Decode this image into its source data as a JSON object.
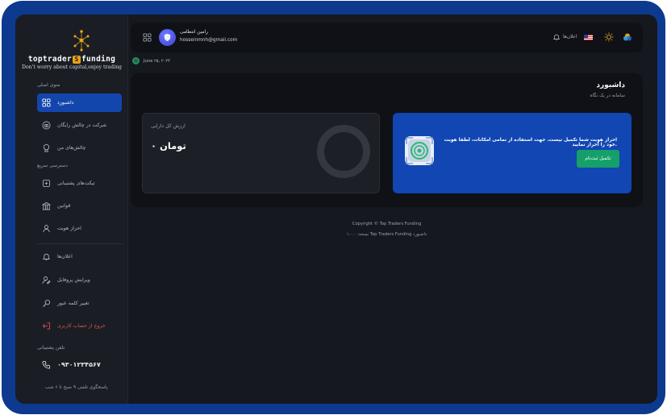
{
  "brand": {
    "name_left": "toptrader",
    "badge": "S",
    "name_right": "funding",
    "tagline": "Don't worry about capital,enjoy trading"
  },
  "sidebar": {
    "main_menu_title": "منوی اصلی",
    "quick_access_title": "دسترسی سریع",
    "items": [
      {
        "label": "داشبورد",
        "icon": "dashboard-grid-icon",
        "active": true
      },
      {
        "label": "شرکت در چالش رایگان",
        "icon": "gift-icon"
      },
      {
        "label": "چالش‌های من",
        "icon": "trophy-icon"
      },
      {
        "label": "تیکت‌های پشتیبانی",
        "icon": "ticket-icon"
      },
      {
        "label": "قوانین",
        "icon": "rules-icon"
      },
      {
        "label": "احراز هویت",
        "icon": "identity-icon"
      },
      {
        "label": "اعلان‌ها",
        "icon": "bell-icon"
      },
      {
        "label": "ویرایش پروفایل",
        "icon": "user-edit-icon"
      },
      {
        "label": "تغییر کلمه عبور",
        "icon": "key-icon"
      },
      {
        "label": "خروج از حساب کاربری",
        "icon": "logout-icon",
        "danger": true
      }
    ],
    "support_title": "تلفن پشتیبانی",
    "support_phone": "۰۹۳۰۱۲۳۴۵۶۷",
    "support_hours": "پاسخگوی تلفنی ۹ صبح تا ۶ شب"
  },
  "header": {
    "user_name": "رامین انتظامی",
    "user_email": "hosseinmnh@gmail.com",
    "notifications_label": "اعلان‌ها"
  },
  "date": "June ۲۵, ۲۰۲۴",
  "main": {
    "title": "داشبورد",
    "subtitle": "سامانه در یک نگاه",
    "balance_label": "ارزش کل دارایی",
    "balance_value": "تومان ۰",
    "kyc_message": "احراز هویت شما تکمیل نیست. جهت استفاده از تمامی امکانات، لطفا هویت خود را احراز نمایید.",
    "kyc_button": "تکمیل ثبت‌نام"
  },
  "footer": {
    "copyright": "Copyright © Top Traders Funding",
    "version": "نسخه: ۱.۰.۰ Top Traders Funding داشبورد"
  },
  "colors": {
    "accent": "#1346ad",
    "success": "#15a06a",
    "danger": "#e15656",
    "frame": "#0d3a8e"
  }
}
